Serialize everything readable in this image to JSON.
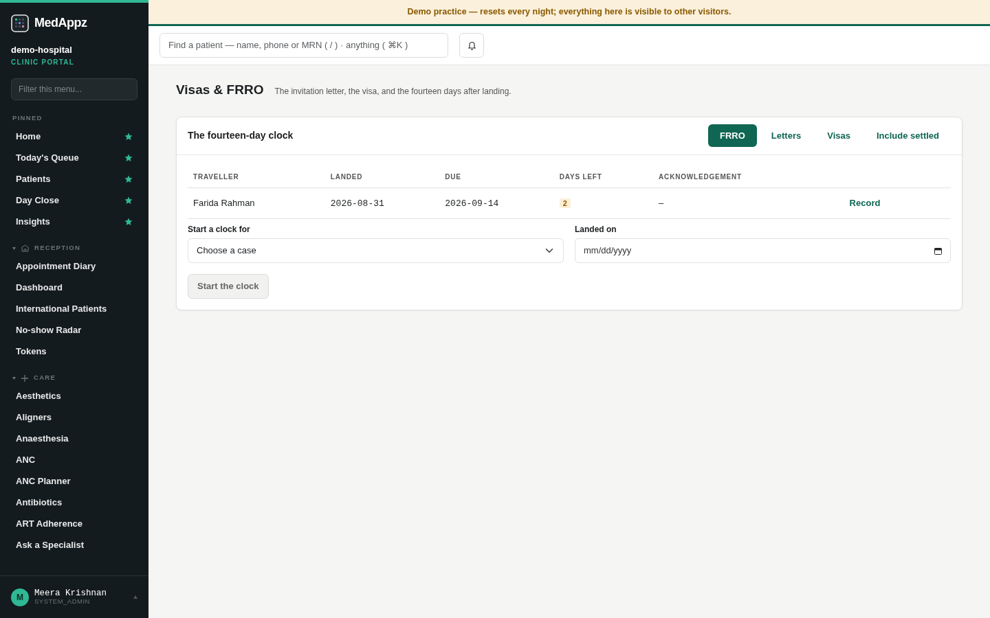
{
  "brand": {
    "name": "MedAppz",
    "org": "demo-hospital",
    "portal": "CLINIC PORTAL"
  },
  "sidebar": {
    "filter_placeholder": "Filter this menu...",
    "sections": [
      {
        "title": "PINNED",
        "kind": "pinned",
        "items": [
          {
            "label": "Home",
            "pinned": true
          },
          {
            "label": "Today's Queue",
            "pinned": true
          },
          {
            "label": "Patients",
            "pinned": true
          },
          {
            "label": "Day Close",
            "pinned": true
          },
          {
            "label": "Insights",
            "pinned": true
          }
        ]
      },
      {
        "title": "RECEPTION",
        "kind": "building",
        "expanded": true,
        "items": [
          {
            "label": "Appointment Diary",
            "pinned": false
          },
          {
            "label": "Dashboard",
            "pinned": false
          },
          {
            "label": "International Patients",
            "pinned": false
          },
          {
            "label": "No-show Radar",
            "pinned": false
          },
          {
            "label": "Tokens",
            "pinned": false
          }
        ]
      },
      {
        "title": "CARE",
        "kind": "plus",
        "expanded": true,
        "items": [
          {
            "label": "Aesthetics",
            "pinned": false
          },
          {
            "label": "Aligners",
            "pinned": false
          },
          {
            "label": "Anaesthesia",
            "pinned": false
          },
          {
            "label": "ANC",
            "pinned": false
          },
          {
            "label": "ANC Planner",
            "pinned": false
          },
          {
            "label": "Antibiotics",
            "pinned": false
          },
          {
            "label": "ART Adherence",
            "pinned": false
          },
          {
            "label": "Ask a Specialist",
            "pinned": false
          }
        ]
      }
    ],
    "user": {
      "initial": "M",
      "name": "Meera Krishnan",
      "role": "SYSTEM_ADMIN"
    }
  },
  "banner": "Demo practice — resets every night; everything here is visible to other visitors.",
  "search": {
    "placeholder": "Find a patient — name, phone or MRN ( / ) · anything ( ⌘K )"
  },
  "page": {
    "title": "Visas & FRRO",
    "subtitle": "The invitation letter, the visa, and the fourteen days after landing."
  },
  "card": {
    "title": "The fourteen-day clock",
    "tabs": [
      {
        "label": "FRRO",
        "selected": true
      },
      {
        "label": "Letters",
        "selected": false
      },
      {
        "label": "Visas",
        "selected": false
      },
      {
        "label": "Include settled",
        "selected": false
      }
    ],
    "table": {
      "columns": [
        "TRAVELLER",
        "LANDED",
        "DUE",
        "DAYS LEFT",
        "ACKNOWLEDGEMENT"
      ],
      "rows": [
        {
          "traveller": "Farida Rahman",
          "landed": "2026-08-31",
          "due": "2026-09-14",
          "days_left": "2",
          "acknowledgement": "–",
          "action": "Record"
        }
      ]
    },
    "form": {
      "case_label": "Start a clock for",
      "case_value": "Choose a case",
      "date_label": "Landed on",
      "date_placeholder": "mm/dd/yyyy",
      "submit": "Start the clock"
    }
  }
}
